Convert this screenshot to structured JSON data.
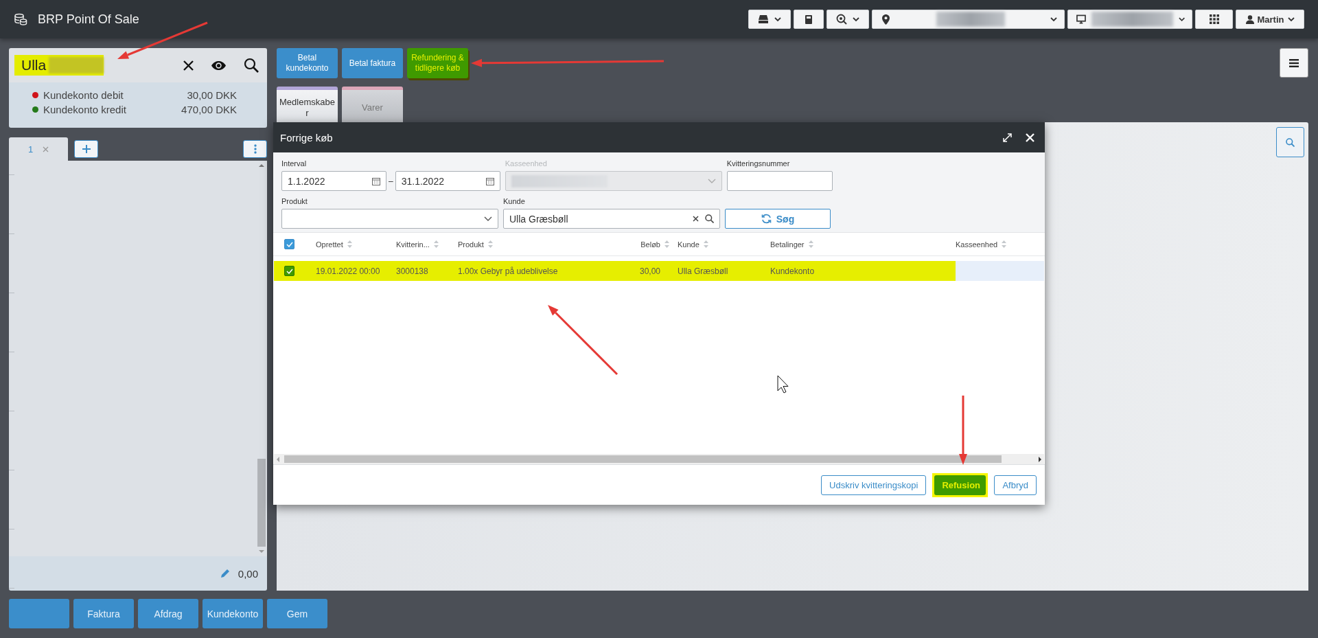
{
  "app": {
    "title": "BRP Point Of Sale"
  },
  "toolbar": {
    "user": "Martin"
  },
  "customer": {
    "name": "Ulla",
    "highlighted": true,
    "accounts": [
      {
        "label": "Kundekonto debit",
        "amount": "30,00 DKK",
        "color": "#d0141b"
      },
      {
        "label": "Kundekonto kredit",
        "amount": "470,00 DKK",
        "color": "#257a1a"
      }
    ]
  },
  "action_buttons": [
    {
      "label": "Betal kundekonto",
      "selected": false
    },
    {
      "label": "Betal faktura",
      "selected": false
    },
    {
      "label": "Refundering & tidligere køb",
      "selected": true
    }
  ],
  "tiles": [
    {
      "label": "Medlemskaber",
      "color": "#b2a6d8",
      "disabled": false
    },
    {
      "label": "Varer",
      "color": "#dba6b8",
      "disabled": true
    }
  ],
  "cart": {
    "tabs": [
      {
        "label": "1",
        "selected": true
      }
    ],
    "total": "0,00"
  },
  "dialog": {
    "title": "Forrige køb",
    "filters": {
      "interval_label": "Interval",
      "from": "1.1.2022",
      "to": "31.1.2022",
      "range_separator": "–",
      "register_label": "Kasseenhed",
      "register_disabled": true,
      "receipt_label": "Kvitteringsnummer",
      "product_label": "Produkt",
      "customer_label": "Kunde",
      "customer_value": "Ulla Græsbøll",
      "search_button": "Søg"
    },
    "table": {
      "all_checked": true,
      "columns": [
        {
          "label": "Oprettet"
        },
        {
          "label": "Kvitterin..."
        },
        {
          "label": "Produkt"
        },
        {
          "label": "Beløb"
        },
        {
          "label": "Kunde"
        },
        {
          "label": "Betalinger"
        },
        {
          "label": "Kasseenhed"
        }
      ],
      "rows": [
        {
          "checked": true,
          "highlighted": true,
          "cells": [
            "19.01.2022 00:00",
            "3000138",
            "1.00x Gebyr på udeblivelse",
            "30,00",
            "Ulla Græsbøll",
            "Kundekonto"
          ]
        }
      ]
    },
    "buttons": [
      {
        "label": "Udskriv kvitteringskopi",
        "kind": "outline",
        "highlighted": false
      },
      {
        "label": "Refusion",
        "kind": "primary",
        "highlighted": true
      },
      {
        "label": "Afbryd",
        "kind": "outline",
        "highlighted": false
      }
    ]
  },
  "bottom_buttons": [
    {
      "label": "Faktura"
    },
    {
      "label": "Afdrag"
    },
    {
      "label": "Kundekonto"
    },
    {
      "label": "Gem"
    }
  ]
}
